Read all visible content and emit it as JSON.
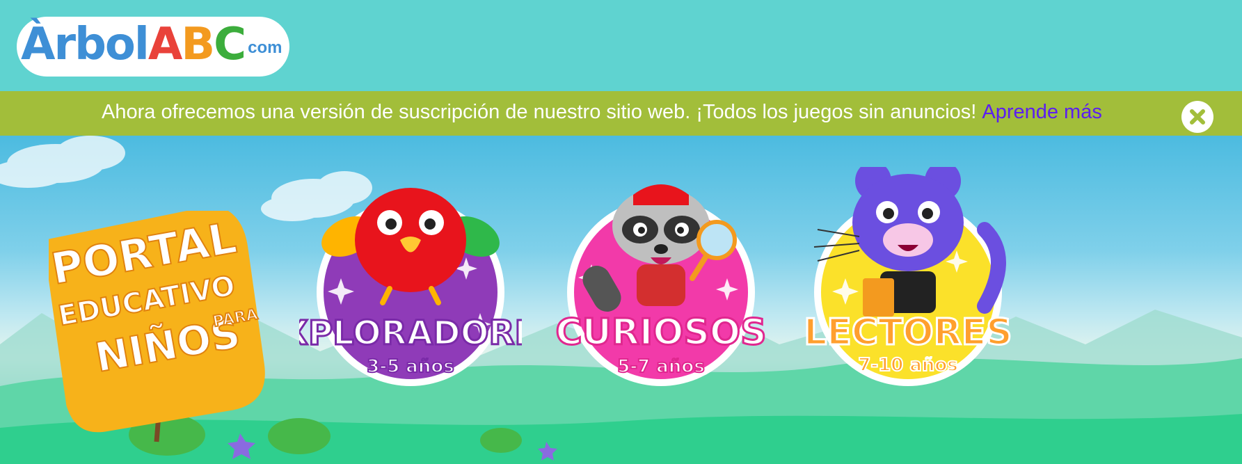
{
  "header": {
    "logo": {
      "word": "Àrbol",
      "a": "A",
      "b": "B",
      "c": "C",
      "com": "com"
    }
  },
  "banner": {
    "message": "Ahora ofrecemos una versión de suscripción de nuestro sitio web. ¡Todos los juegos sin anuncios!",
    "link_label": "Aprende más",
    "close_icon": "close-x-icon"
  },
  "hero": {
    "portal": {
      "line1": "PORTAL",
      "line2": "EDUCATIVO",
      "line3": "NIÑOS",
      "para": "PARA"
    },
    "cards": [
      {
        "title": "EXPLORADORES",
        "ages": "3-5 años",
        "character": "red-parrot",
        "color": "#8f3bb8",
        "title_color": "#ffffff",
        "title_stroke": "#7a2aa8"
      },
      {
        "title": "CURIOSOS",
        "ages": "5-7 años",
        "character": "raccoon",
        "color": "#f23aa9",
        "title_color": "#ffffff",
        "title_stroke": "#e0278f"
      },
      {
        "title": "LECTORES",
        "ages": "7-10 años",
        "character": "purple-cat",
        "color": "#fbe12a",
        "title_color": "#ff9f2e",
        "title_stroke": "#ffffff"
      }
    ]
  },
  "colors": {
    "header_bg": "#5fd3d0",
    "banner_bg": "#a2be3a",
    "link": "#5b1ef0"
  }
}
